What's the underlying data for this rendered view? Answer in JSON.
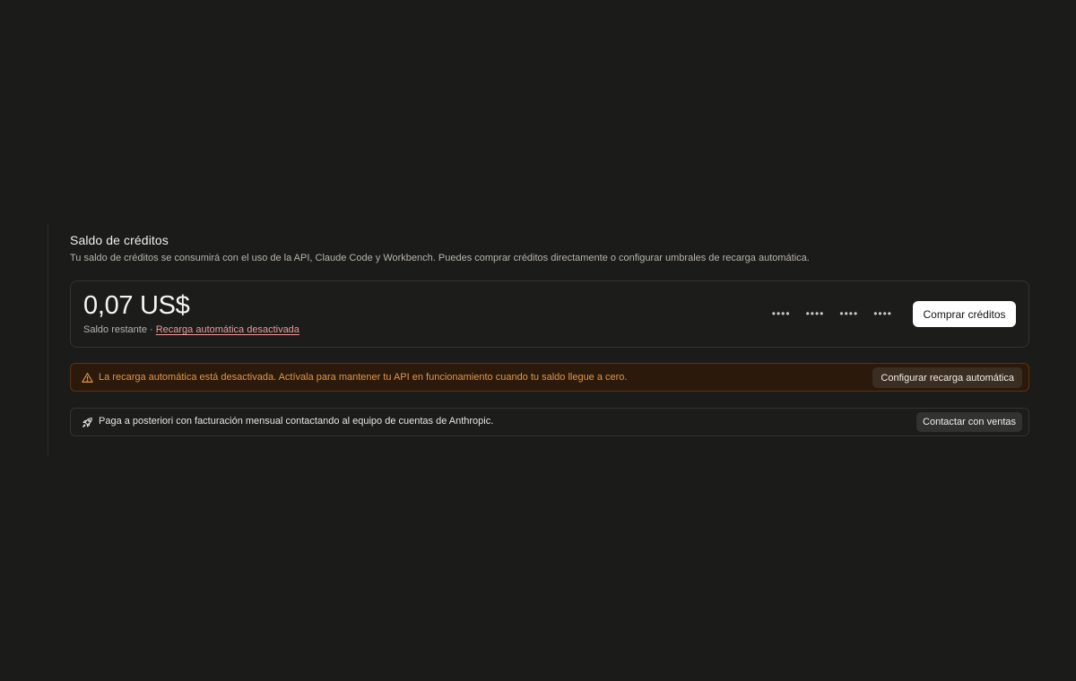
{
  "credits": {
    "title": "Saldo de créditos",
    "description": "Tu saldo de créditos se consumirá con el uso de la API, Claude Code y Workbench. Puedes comprar créditos directamente o configurar umbrales de recarga automática.",
    "balance": {
      "amount": "0,07 US$",
      "label": "Saldo restante ·",
      "auto_reload_link": "Recarga automática desactivada",
      "card_masked": [
        "••••",
        "••••",
        "••••",
        "••••"
      ],
      "buy_button": "Comprar créditos"
    },
    "warning": {
      "icon": "warning-triangle-icon",
      "text": "La recarga automática está desactivada. Actívala para mantener tu API en funcionamiento cuando tu saldo llegue a cero.",
      "button": "Configurar recarga automática",
      "color": "#e0954a"
    },
    "postpay": {
      "icon": "rocket-icon",
      "text": "Paga a posteriori con facturación mensual contactando al equipo de cuentas de Anthropic.",
      "button": "Contactar con ventas"
    }
  }
}
